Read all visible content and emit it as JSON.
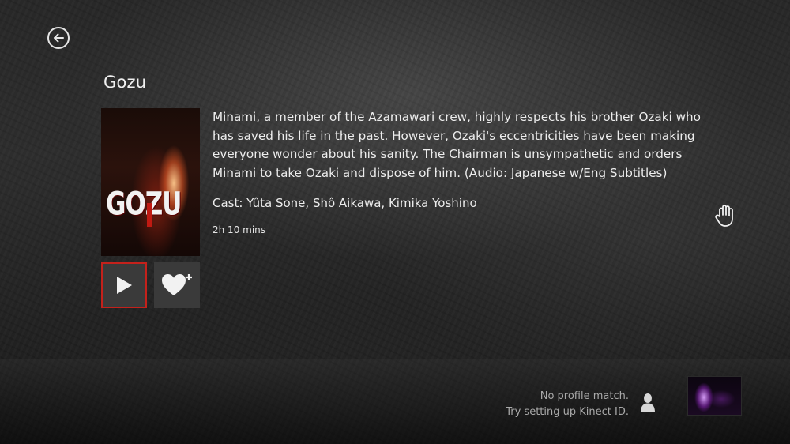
{
  "title": "Gozu",
  "description": "Minami, a member of the Azamawari crew, highly respects his brother Ozaki who has saved his life in the past. However, Ozaki's eccentricities have been making everyone wonder about his sanity. The Chairman is unsympathetic and orders Minami to take Ozaki and dispose of him. (Audio: Japanese w/Eng Subtitles)",
  "cast": "Cast: Yûta Sone, Shô Aikawa, Kimika Yoshino",
  "duration": "2h 10 mins",
  "poster": {
    "logo_text": "GOZU"
  },
  "actions": {
    "play_icon": "play-icon",
    "favorite_icon": "heart-plus-icon"
  },
  "kinect": {
    "line1": "No profile match.",
    "line2": "Try setting up Kinect ID."
  },
  "colors": {
    "accent": "#c4211b",
    "tile": "#3a3a3a",
    "text": "#ededed",
    "muted": "#a9a9a9"
  },
  "icons": [
    "back-arrow-icon",
    "hand-cursor-icon",
    "person-icon"
  ]
}
